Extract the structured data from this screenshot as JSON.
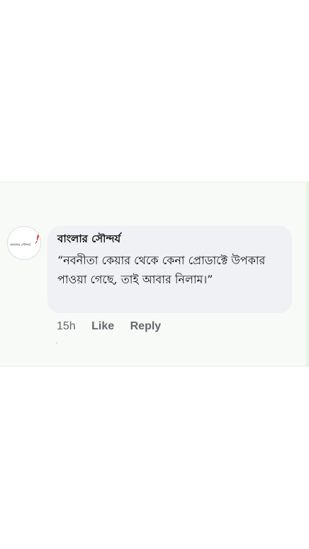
{
  "comment": {
    "author": "বাংলার সৌন্দর্য",
    "text": "“নবনীতা কেয়ার থেকে কেনা প্রোডাক্টে উপকার পাওয়া গেছে, তাই আবার নিলাম।”",
    "time": "15h",
    "like_label": "Like",
    "reply_label": "Reply"
  },
  "avatar": {
    "logo_text": "বাংলার সৌন্দর্য",
    "icon": "red-feather-icon"
  },
  "colors": {
    "bubble": "#eff1f4",
    "meta_text": "#65676b",
    "background": "#ffffff",
    "accent": "#d82a2a"
  }
}
